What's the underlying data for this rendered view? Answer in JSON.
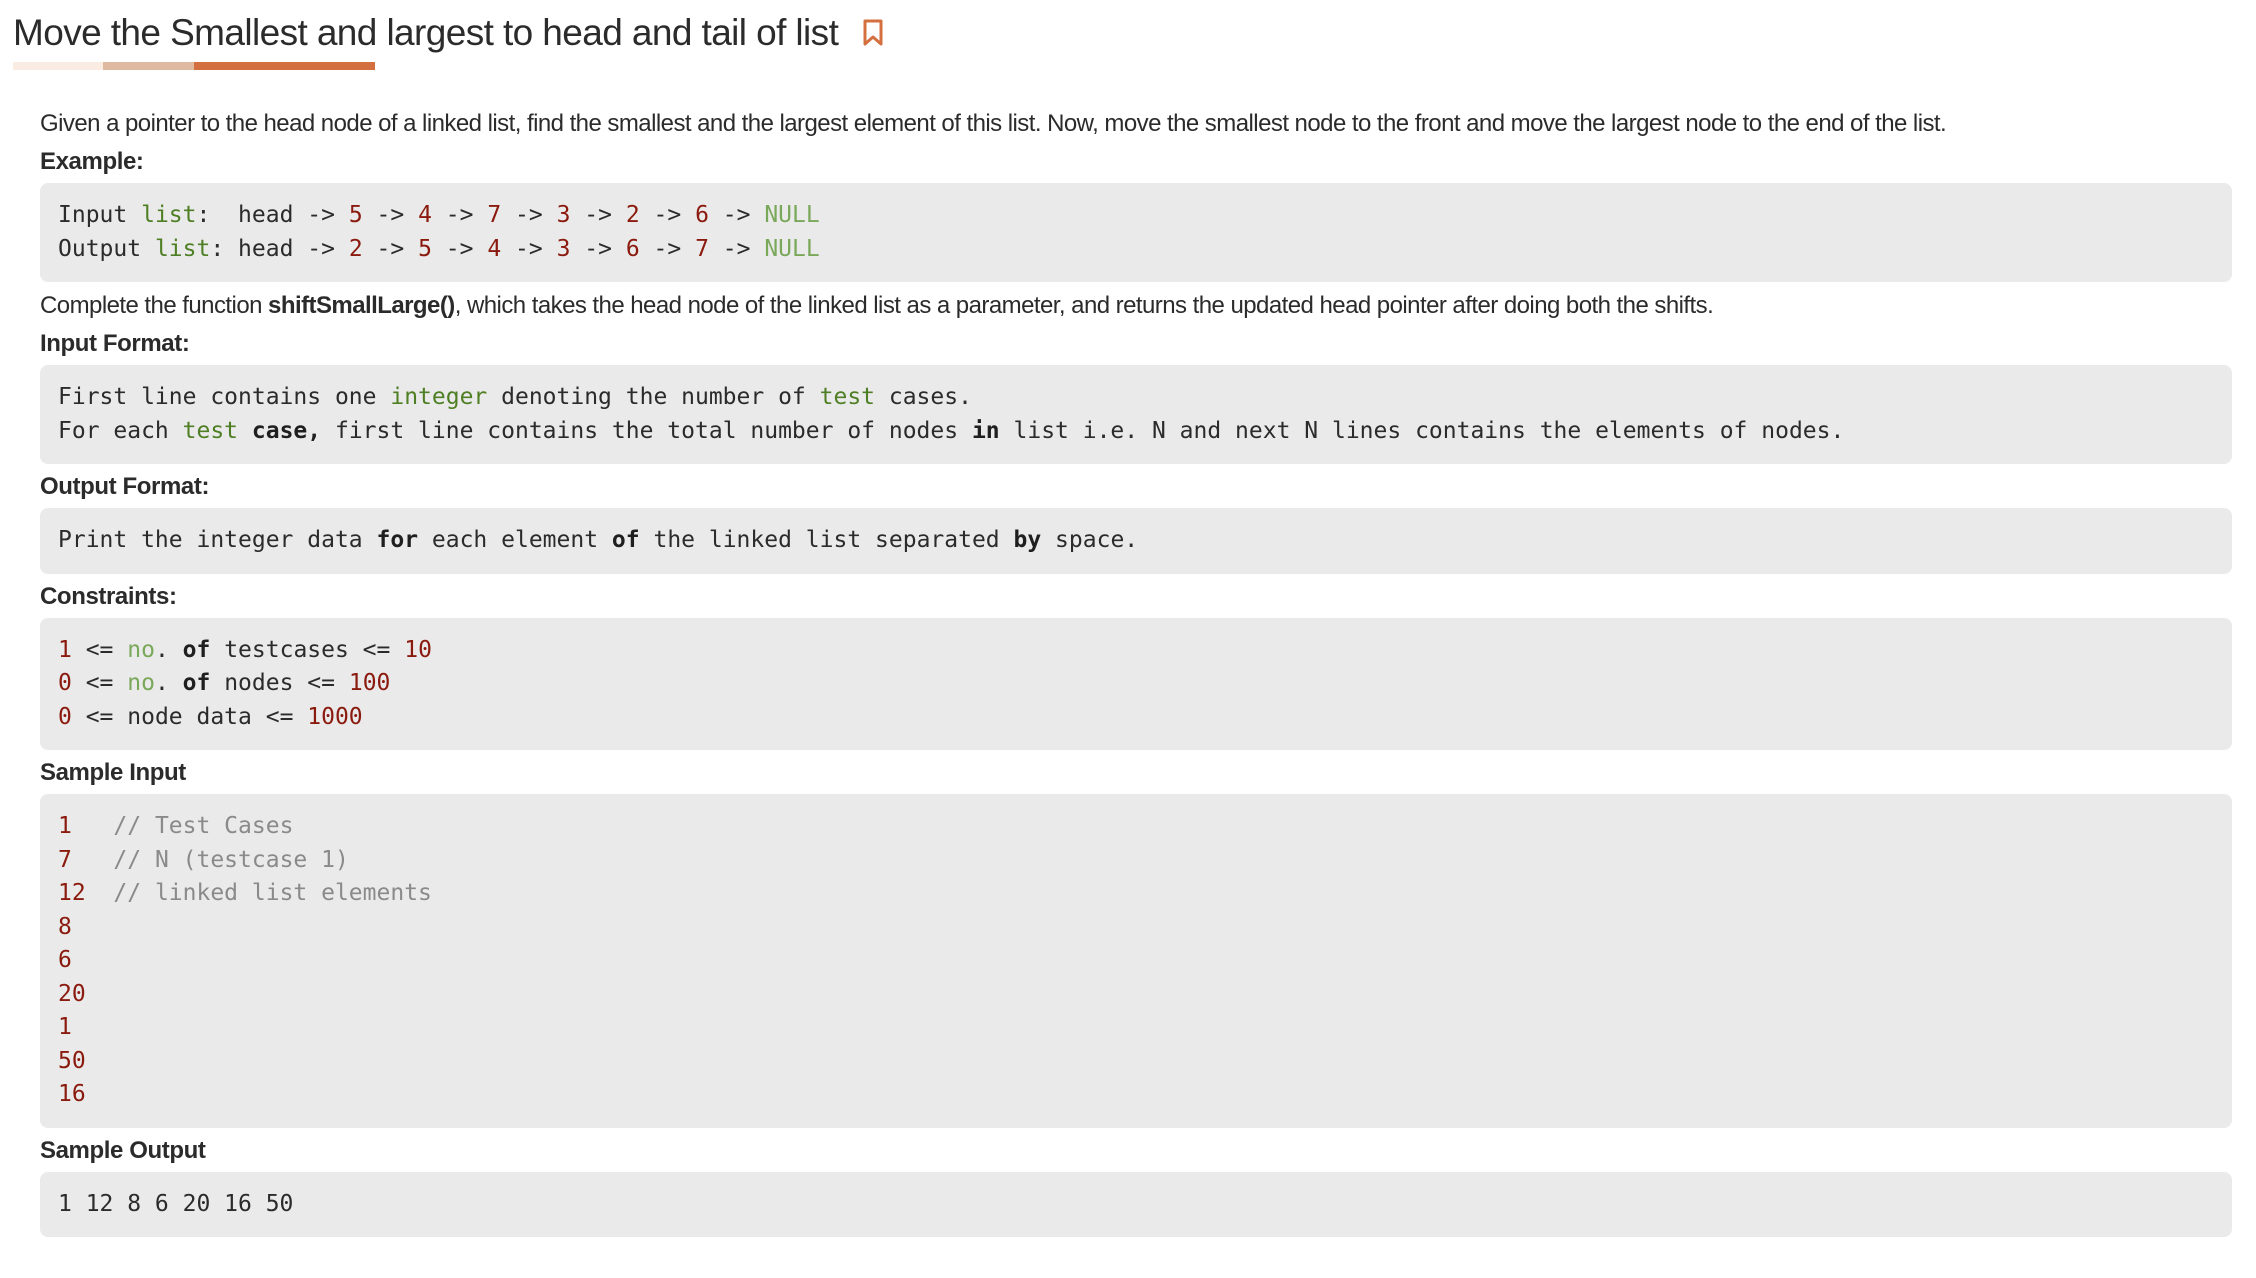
{
  "title": "Move the Smallest and largest to head and tail of list",
  "colors": {
    "accent": "#d4703f",
    "accent_mid": "#dfb9a0",
    "accent_light": "#fbece3",
    "code_bg": "#eaeaea",
    "number": "#8b1a0e",
    "keyword": "#4f7f24",
    "literal": "#7aa85a",
    "comment": "#8a8a8a"
  },
  "icons": {
    "bookmark": "bookmark-icon"
  },
  "description": "Given a pointer to the head node of a linked list, find the smallest and the largest element of this list. Now, move the smallest node to the front and move the largest node to the end of the list.",
  "example_heading": "Example:",
  "example_code": [
    [
      {
        "t": "Input "
      },
      {
        "t": "list",
        "c": "kw"
      },
      {
        "t": ":  head -> "
      },
      {
        "t": "5",
        "c": "num"
      },
      {
        "t": " -> "
      },
      {
        "t": "4",
        "c": "num"
      },
      {
        "t": " -> "
      },
      {
        "t": "7",
        "c": "num"
      },
      {
        "t": " -> "
      },
      {
        "t": "3",
        "c": "num"
      },
      {
        "t": " -> "
      },
      {
        "t": "2",
        "c": "num"
      },
      {
        "t": " -> "
      },
      {
        "t": "6",
        "c": "num"
      },
      {
        "t": " -> "
      },
      {
        "t": "NULL",
        "c": "lit"
      }
    ],
    [
      {
        "t": "Output "
      },
      {
        "t": "list",
        "c": "kw"
      },
      {
        "t": ": head -> "
      },
      {
        "t": "2",
        "c": "num"
      },
      {
        "t": " -> "
      },
      {
        "t": "5",
        "c": "num"
      },
      {
        "t": " -> "
      },
      {
        "t": "4",
        "c": "num"
      },
      {
        "t": " -> "
      },
      {
        "t": "3",
        "c": "num"
      },
      {
        "t": " -> "
      },
      {
        "t": "6",
        "c": "num"
      },
      {
        "t": " -> "
      },
      {
        "t": "7",
        "c": "num"
      },
      {
        "t": " -> "
      },
      {
        "t": "NULL",
        "c": "lit"
      }
    ]
  ],
  "task": {
    "before": "Complete the function ",
    "function_name": "shiftSmallLarge()",
    "after": ", which takes the head node of the linked list as a parameter, and returns the updated head pointer after doing both the shifts."
  },
  "input_format_heading": "Input Format:",
  "input_format_code": [
    [
      {
        "t": "First line contains one "
      },
      {
        "t": "integer",
        "c": "kw"
      },
      {
        "t": " denoting the number of "
      },
      {
        "t": "test",
        "c": "kw"
      },
      {
        "t": " cases."
      }
    ],
    [
      {
        "t": "For each "
      },
      {
        "t": "test",
        "c": "kw"
      },
      {
        "t": " "
      },
      {
        "t": "case,",
        "c": "b"
      },
      {
        "t": " first line contains the total number of nodes "
      },
      {
        "t": "in",
        "c": "b"
      },
      {
        "t": " list i.e. N and next N lines contains the elements of nodes."
      }
    ]
  ],
  "output_format_heading": "Output Format:",
  "output_format_code": [
    [
      {
        "t": "Print the integer data "
      },
      {
        "t": "for",
        "c": "b"
      },
      {
        "t": " each element "
      },
      {
        "t": "of",
        "c": "b"
      },
      {
        "t": " the linked list separated "
      },
      {
        "t": "by",
        "c": "b"
      },
      {
        "t": " space."
      }
    ]
  ],
  "constraints_heading": "Constraints:",
  "constraints_code": [
    [
      {
        "t": "1",
        "c": "num"
      },
      {
        "t": " <= "
      },
      {
        "t": "no",
        "c": "lit"
      },
      {
        "t": ". "
      },
      {
        "t": "of",
        "c": "b"
      },
      {
        "t": " testcases <= "
      },
      {
        "t": "10",
        "c": "num"
      }
    ],
    [
      {
        "t": "0",
        "c": "num"
      },
      {
        "t": " <= "
      },
      {
        "t": "no",
        "c": "lit"
      },
      {
        "t": ". "
      },
      {
        "t": "of",
        "c": "b"
      },
      {
        "t": " nodes <= "
      },
      {
        "t": "100",
        "c": "num"
      }
    ],
    [
      {
        "t": "0",
        "c": "num"
      },
      {
        "t": " <= node data <= "
      },
      {
        "t": "1000",
        "c": "num"
      }
    ]
  ],
  "sample_input_heading": "Sample Input",
  "sample_input_code": [
    [
      {
        "t": "1",
        "c": "num"
      },
      {
        "t": "   "
      },
      {
        "t": "// Test Cases",
        "c": "cm"
      }
    ],
    [
      {
        "t": "7",
        "c": "num"
      },
      {
        "t": "   "
      },
      {
        "t": "// N (testcase 1)",
        "c": "cm"
      }
    ],
    [
      {
        "t": "12",
        "c": "num"
      },
      {
        "t": "  "
      },
      {
        "t": "// linked list elements",
        "c": "cm"
      }
    ],
    [
      {
        "t": "8",
        "c": "num"
      }
    ],
    [
      {
        "t": "6",
        "c": "num"
      }
    ],
    [
      {
        "t": "20",
        "c": "num"
      }
    ],
    [
      {
        "t": "1",
        "c": "num"
      }
    ],
    [
      {
        "t": "50",
        "c": "num"
      }
    ],
    [
      {
        "t": "16",
        "c": "num"
      }
    ]
  ],
  "sample_output_heading": "Sample Output",
  "sample_output_code": [
    [
      {
        "t": "1 12 8 6 20 16 50"
      }
    ]
  ]
}
